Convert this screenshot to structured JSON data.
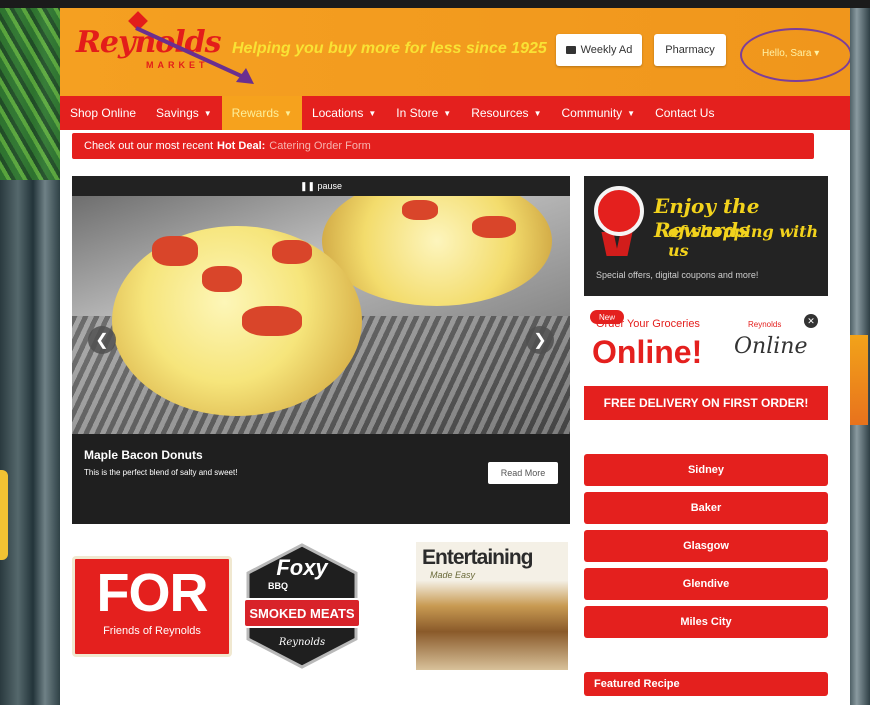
{
  "header": {
    "logo_text": "Reynolds",
    "logo_sub": "MARKET",
    "tagline": "Helping you buy more for less since 1925",
    "weekly_ad_label": "Weekly Ad",
    "pharmacy_label": "Pharmacy",
    "greeting": "Hello, Sara ▾",
    "accent_color": "#e4201e",
    "header_color": "#f5a021"
  },
  "nav": {
    "items": [
      {
        "label": "Shop Online",
        "caret": ""
      },
      {
        "label": "Savings",
        "caret": "▼"
      },
      {
        "label": "Rewards",
        "caret": "▼"
      },
      {
        "label": "Locations",
        "caret": "▼"
      },
      {
        "label": "In Store",
        "caret": "▼"
      },
      {
        "label": "Resources",
        "caret": "▼"
      },
      {
        "label": "Community",
        "caret": "▼"
      },
      {
        "label": "Contact Us",
        "caret": ""
      }
    ],
    "active_index": 2
  },
  "hot_deal": {
    "prefix": "Check out our most recent",
    "bold": "Hot Deal:",
    "link": "Catering Order Form"
  },
  "slider": {
    "pause_label": "❚❚ pause",
    "title": "Maple Bacon Donuts",
    "description": "This is the perfect blend of salty and sweet!",
    "read_more": "Read More",
    "prev_icon": "❮",
    "next_icon": "❯"
  },
  "promos": {
    "for_big": "FOR",
    "for_sub": "Friends of Reynolds",
    "foxy_top": "Foxy",
    "foxy_bbq": "BBQ",
    "foxy_main": "SMOKED MEATS",
    "foxy_brand": "Reynolds",
    "entertaining_title": "Entertaining",
    "entertaining_sub": "Made Easy"
  },
  "rewards_banner": {
    "line1": "Enjoy the Rewards",
    "line2": "of shopping with us",
    "note": "Special offers, digital coupons and more!",
    "ribbon_label": "Reynolds"
  },
  "online_banner": {
    "badge": "New",
    "order_text": "Order Your Groceries",
    "big_text": "Online!",
    "script_text": "Online",
    "mini_text": "Reynolds",
    "close_icon": "✕",
    "free_delivery": "FREE DELIVERY ON FIRST ORDER!"
  },
  "stores": [
    "Sidney",
    "Baker",
    "Glasgow",
    "Glendive",
    "Miles City"
  ],
  "featured_recipe": "Featured Recipe"
}
